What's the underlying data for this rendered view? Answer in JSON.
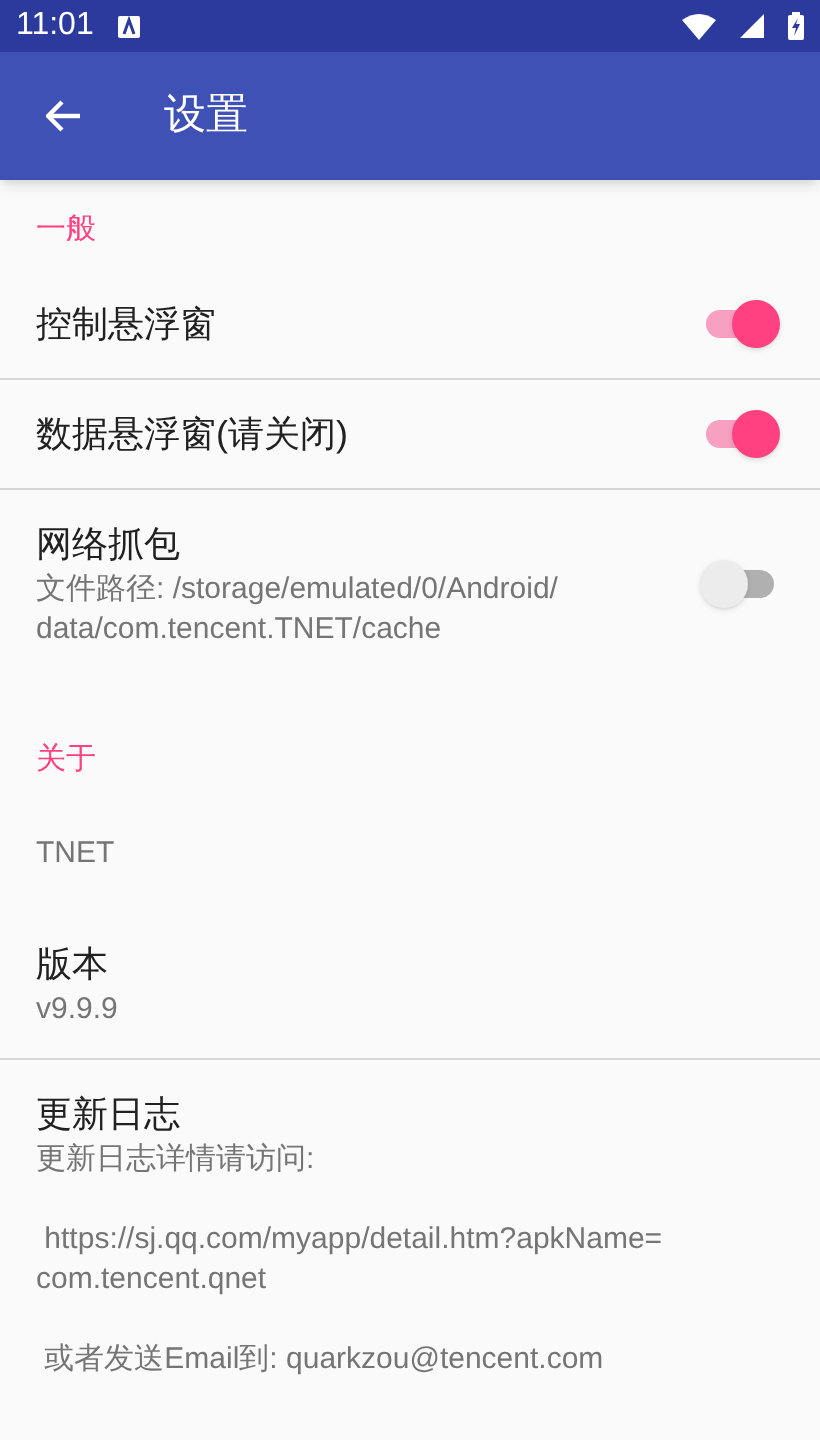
{
  "status_bar": {
    "time": "11:01"
  },
  "app_bar": {
    "title": "设置"
  },
  "sections": [
    {
      "header": "一般",
      "items": [
        {
          "kind": "switch",
          "title": "控制悬浮窗",
          "on": true,
          "divider": true
        },
        {
          "kind": "switch",
          "title": "数据悬浮窗(请关闭)",
          "on": true,
          "divider": true
        },
        {
          "kind": "switch",
          "title": "网络抓包",
          "summary": "文件路径: /storage/emulated/0/Android/\ndata/com.tencent.TNET/cache",
          "on": false,
          "divider": false
        }
      ]
    },
    {
      "header": "关于",
      "items": [
        {
          "kind": "text",
          "summary": "TNET",
          "divider": false
        },
        {
          "kind": "text",
          "title": "版本",
          "summary": "v9.9.9",
          "divider": true
        },
        {
          "kind": "text",
          "title": "更新日志",
          "summary": "更新日志详情请访问:\n\n https://sj.qq.com/myapp/detail.htm?apkName=\ncom.tencent.qnet\n\n 或者发送Email到: quarkzou@tencent.com",
          "divider": false
        }
      ]
    }
  ]
}
